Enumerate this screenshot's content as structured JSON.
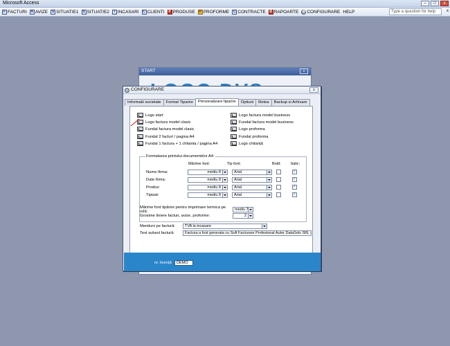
{
  "app_title": "Microsoft Access",
  "window_controls": {
    "minimize": "–",
    "maximize": "□",
    "close": "x"
  },
  "menu": [
    {
      "id": "facturi",
      "label": "FACTURI",
      "icon": "F"
    },
    {
      "id": "avize",
      "label": "AVIZE",
      "icon": "A"
    },
    {
      "id": "situatie1",
      "label": "SITUATIE1",
      "icon": "S"
    },
    {
      "id": "situatie2",
      "label": "SITUATIE2",
      "icon": "S"
    },
    {
      "id": "incasari",
      "label": "INCASARI",
      "icon": "I"
    },
    {
      "id": "clienti",
      "label": "CLIENTI",
      "icon": "C"
    },
    {
      "id": "produse",
      "label": "PRODUSE",
      "icon": "P"
    },
    {
      "id": "proforme",
      "label": "PROFORME",
      "icon": "P"
    },
    {
      "id": "contracte",
      "label": "CONTRACTE",
      "icon": "C"
    },
    {
      "id": "rapoarte",
      "label": "RAPOARTE",
      "icon": "R"
    },
    {
      "id": "configurare",
      "label": "CONFIGURARE",
      "icon": "⚙"
    },
    {
      "id": "help",
      "label": "HELP",
      "icon": ""
    }
  ],
  "help_placeholder": "Type a question for help",
  "help_close": "x",
  "start_window": {
    "title": "START",
    "close": "x",
    "logo_text": "LOGO DVS"
  },
  "config_window": {
    "title": "CONFIGURARE",
    "close": "x",
    "tabs": [
      "Informatii societate",
      "Format Tiparire",
      "Personalizare tiparire",
      "Optiuni",
      "Retea",
      "Backup si Arhivare"
    ],
    "active_tab": 2,
    "logo_left": [
      "Logo start",
      "Logo factura model clasic",
      "Fundal factura model clasic",
      "Fundal 2 facturi / pagina A4",
      "Fundal 1 factura + 1 chitanta / pagina A4"
    ],
    "logo_right": [
      "Logo factura model business",
      "Fundal factura model business",
      "Logo proforma",
      "Fundal proforma",
      "Logo chitanță"
    ],
    "format_group": {
      "title": "Formatarea printului documentelor A4:",
      "headers": {
        "size": "Mărime font:",
        "type": "Tip font:",
        "bold": "Bold:",
        "italic": "Italic:"
      },
      "rows": [
        {
          "label": "Nume firma:",
          "size": "mediu 8",
          "font": "Arial",
          "bold": false,
          "italic": true
        },
        {
          "label": "Date firma:",
          "size": "mediu 8",
          "font": "Arial",
          "bold": false,
          "italic": true
        },
        {
          "label": "Produs:",
          "size": "mediu 8",
          "font": "Arial",
          "bold": false,
          "italic": true
        },
        {
          "label": "Tipizat:",
          "size": "mediu 8",
          "font": "Arial",
          "bold": false,
          "italic": true
        }
      ]
    },
    "thermal_label": "Mărime font tipărire pentru imprimare termica pe rolă:",
    "thermal_value": "mediu 7",
    "thickness_label": "Grosime liniere facturi, avize, proforme:",
    "thickness_value": "2",
    "mentions_label": "Mentiuni pe factură:",
    "mentions_value": "TVA la incasare",
    "footer_label": "Text subsol factură:",
    "footer_value": "Factura a fost generata cu Soft Facturare Profesional Autor DataSolv SRL n",
    "license_label": "nr. licență",
    "license_value": "DEMO"
  }
}
